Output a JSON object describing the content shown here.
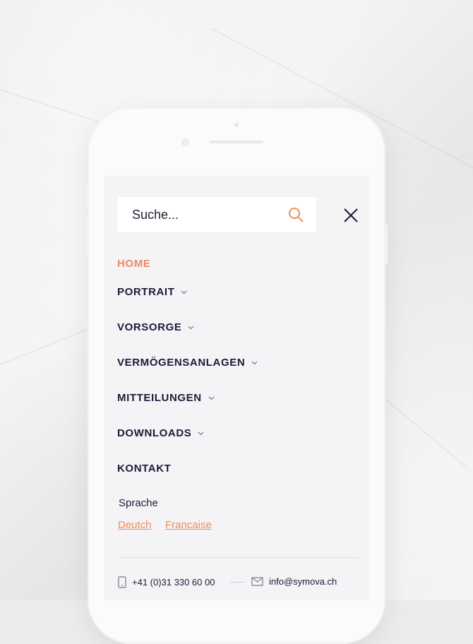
{
  "search": {
    "placeholder": "Suche..."
  },
  "nav": {
    "items": [
      {
        "label": "HOME",
        "active": true,
        "has_submenu": false
      },
      {
        "label": "PORTRAIT",
        "active": false,
        "has_submenu": true
      },
      {
        "label": "VORSORGE",
        "active": false,
        "has_submenu": true
      },
      {
        "label": "VERMÖGENSANLAGEN",
        "active": false,
        "has_submenu": true
      },
      {
        "label": "MITTEILUNGEN",
        "active": false,
        "has_submenu": true
      },
      {
        "label": "DOWNLOADS",
        "active": false,
        "has_submenu": true
      },
      {
        "label": "KONTAKT",
        "active": false,
        "has_submenu": false
      }
    ]
  },
  "language": {
    "title": "Sprache",
    "options": [
      "Deutch",
      "Francaise"
    ]
  },
  "contact": {
    "phone": "+41 (0)31 330 60 00",
    "email": "info@symova.ch"
  },
  "colors": {
    "accent": "#f08a5d",
    "text": "#1c1b3a",
    "screen_bg": "#f4f4f6"
  },
  "icons": [
    "search-icon",
    "close-icon",
    "chevron-down-icon",
    "phone-icon",
    "mail-icon"
  ]
}
